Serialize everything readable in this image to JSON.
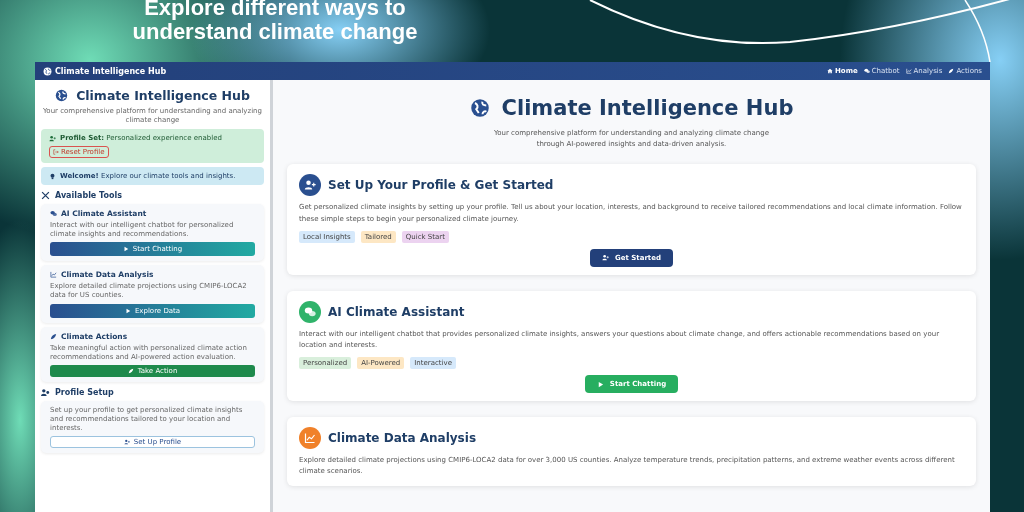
{
  "headline": [
    "Explore different ways to",
    "understand climate change"
  ],
  "navbar": {
    "brand": "Climate Intelligence Hub",
    "items": [
      {
        "label": "Home",
        "kind": "home",
        "selected": true
      },
      {
        "label": "Chatbot",
        "kind": "chat",
        "selected": false
      },
      {
        "label": "Analysis",
        "kind": "chart",
        "selected": false
      },
      {
        "label": "Actions",
        "kind": "action",
        "selected": false
      }
    ]
  },
  "sidebar": {
    "title": "Climate Intelligence Hub",
    "subtitle": "Your comprehensive platform for understanding and analyzing climate change",
    "profile_alert": {
      "text": "**Profile Set:** Personalized experience enabled",
      "button": "Reset Profile"
    },
    "welcome_alert": {
      "text": "**Welcome!** Explore our climate tools and insights."
    },
    "tools_heading": "Available Tools",
    "tools": [
      {
        "kind": "chat",
        "title": "AI Climate Assistant",
        "text": "Interact with our intelligent chatbot for personalized climate insights and recommendations.",
        "button": "Start Chatting"
      },
      {
        "kind": "chart",
        "title": "Climate Data Analysis",
        "text": "Explore detailed climate projections using CMIP6-LOCA2 data for US counties.",
        "button": "Explore Data"
      },
      {
        "kind": "action",
        "title": "Climate Actions",
        "text": "Take meaningful action with personalized climate action recommendations and AI-powered action evaluation.",
        "button": "Take Action"
      }
    ],
    "profile_heading": "Profile Setup",
    "profile_card": {
      "text": "Set up your profile to get personalized climate insights and recommendations tailored to your location and interests.",
      "button": "Set Up Profile"
    }
  },
  "main": {
    "title": "Climate Intelligence Hub",
    "subtitle": "Your comprehensive platform for understanding and analyzing climate change through AI-powered insights and data-driven analysis.",
    "cards": [
      {
        "kind": "profile",
        "title": "Set Up Your Profile & Get Started",
        "text": "Get personalized climate insights by setting up your profile. Tell us about your location, interests, and background to receive tailored recommendations and local climate information. Follow these simple steps to begin your personalized climate journey.",
        "tags": [
          {
            "label": "Local Insights",
            "color": "#d6e9fb"
          },
          {
            "label": "Tailored",
            "color": "#fde7c4"
          },
          {
            "label": "Quick Start",
            "color": "#ecd3f0"
          }
        ],
        "button": "Get Started"
      },
      {
        "kind": "chat",
        "title": "AI Climate Assistant",
        "text": "Interact with our intelligent chatbot that provides personalized climate insights, answers your questions about climate change, and offers actionable recommendations based on your location and interests.",
        "tags": [
          {
            "label": "Personalized",
            "color": "#d9efdc"
          },
          {
            "label": "AI-Powered",
            "color": "#fde7c4"
          },
          {
            "label": "Interactive",
            "color": "#d6e9fb"
          }
        ],
        "button": "Start Chatting"
      },
      {
        "kind": "chart",
        "title": "Climate Data Analysis",
        "text": "Explore detailed climate projections using CMIP6-LOCA2 data for over 3,000 US counties. Analyze temperature trends, precipitation patterns, and extreme weather events across different climate scenarios."
      }
    ]
  }
}
